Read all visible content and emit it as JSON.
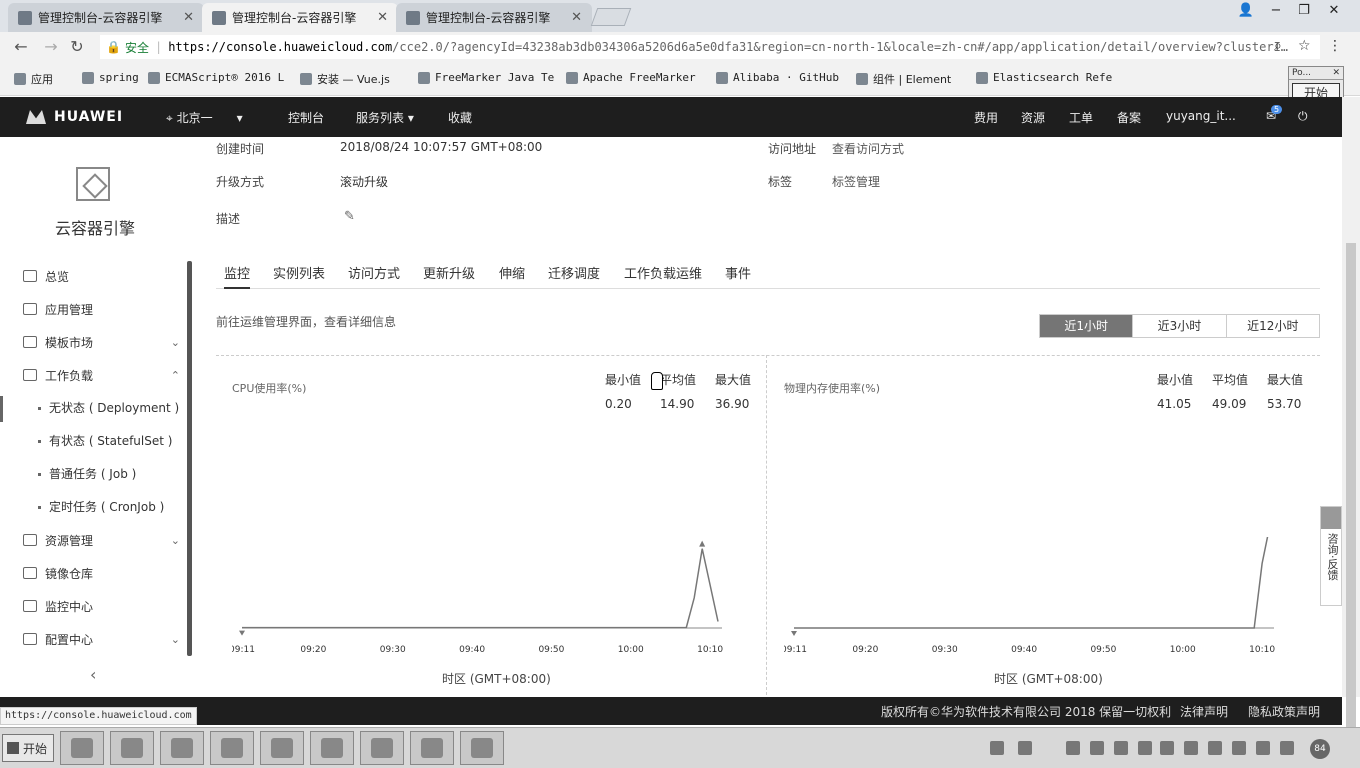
{
  "browser": {
    "tabs": [
      {
        "title": "管理控制台-云容器引擎"
      },
      {
        "title": "管理控制台-云容器引擎"
      },
      {
        "title": "管理控制台-云容器引擎"
      }
    ],
    "security_label": "安全",
    "url_host": "https://console.huaweicloud.com",
    "url_rest": "/cce2.0/?agencyId=43238ab3db034306a5206d6a5e0dfa31&region=cn-north-1&locale=zh-cn#/app/application/detail/overview?clusterI…",
    "bookmarks": [
      {
        "label": "应用"
      },
      {
        "label": "spring"
      },
      {
        "label": "ECMAScript® 2016 L"
      },
      {
        "label": "安装 — Vue.js"
      },
      {
        "label": "FreeMarker Java Te"
      },
      {
        "label": "Apache FreeMarker"
      },
      {
        "label": "Alibaba · GitHub"
      },
      {
        "label": "组件 | Element"
      },
      {
        "label": "Elasticsearch Refe"
      }
    ],
    "popup_title": "Po...",
    "popup_button": "开始"
  },
  "header": {
    "brand": "HUAWEI",
    "region": "北京一",
    "nav": [
      "控制台",
      "服务列表",
      "收藏"
    ],
    "right": [
      "费用",
      "资源",
      "工单",
      "备案",
      "yuyang_it..."
    ],
    "badge": "5"
  },
  "sidebar": {
    "title": "云容器引擎",
    "items": [
      {
        "label": "总览"
      },
      {
        "label": "应用管理"
      },
      {
        "label": "模板市场"
      },
      {
        "label": "工作负载"
      },
      {
        "label": "资源管理"
      },
      {
        "label": "镜像仓库"
      },
      {
        "label": "监控中心"
      },
      {
        "label": "配置中心"
      }
    ],
    "subitems": [
      {
        "label": "无状态 ( Deployment )"
      },
      {
        "label": "有状态 ( StatefulSet )"
      },
      {
        "label": "普通任务 ( Job )"
      },
      {
        "label": "定时任务 ( CronJob )"
      }
    ]
  },
  "detail": {
    "created_label": "创建时间",
    "created_value": "2018/08/24 10:07:57 GMT+08:00",
    "upgrade_label": "升级方式",
    "upgrade_value": "滚动升级",
    "desc_label": "描述",
    "access_label": "访问地址",
    "access_value": "查看访问方式",
    "tag_label": "标签",
    "tag_value": "标签管理"
  },
  "tabs": [
    "监控",
    "实例列表",
    "访问方式",
    "更新升级",
    "伸缩",
    "迁移调度",
    "工作负载运维",
    "事件"
  ],
  "monitor": {
    "hint": "前往运维管理界面，查看详细信息",
    "ranges": [
      "近1小时",
      "近3小时",
      "近12小时"
    ],
    "stat_headers": [
      "最小值",
      "平均值",
      "最大值"
    ],
    "timezone": "时区 (GMT+08:00)"
  },
  "chart_data": [
    {
      "type": "line",
      "title": "CPU使用率(%)",
      "xlabel": "时区 (GMT+08:00)",
      "x_ticks": [
        "09:11",
        "09:20",
        "09:30",
        "09:40",
        "09:50",
        "10:00",
        "10:10"
      ],
      "stats": {
        "min": "0.20",
        "avg": "14.90",
        "max": "36.90"
      },
      "series": [
        {
          "points": [
            [
              "09:11",
              0.2
            ],
            [
              "09:20",
              0.2
            ],
            [
              "09:30",
              0.2
            ],
            [
              "09:40",
              0.2
            ],
            [
              "09:50",
              0.2
            ],
            [
              "10:00",
              0.2
            ],
            [
              "10:07",
              0.2
            ],
            [
              "10:08",
              14.0
            ],
            [
              "10:09",
              36.9
            ],
            [
              "10:10",
              20.0
            ],
            [
              "10:11",
              3.0
            ]
          ]
        }
      ]
    },
    {
      "type": "line",
      "title": "物理内存使用率(%)",
      "xlabel": "时区 (GMT+08:00)",
      "x_ticks": [
        "09:11",
        "09:20",
        "09:30",
        "09:40",
        "09:50",
        "10:00",
        "10:10"
      ],
      "stats": {
        "min": "41.05",
        "avg": "49.09",
        "max": "53.70"
      },
      "series": [
        {
          "points": [
            [
              "09:11",
              0
            ],
            [
              "09:20",
              0
            ],
            [
              "09:30",
              0
            ],
            [
              "09:40",
              0
            ],
            [
              "09:50",
              0
            ],
            [
              "10:00",
              0
            ],
            [
              "10:09",
              0
            ],
            [
              "10:10",
              30.0
            ],
            [
              "10:11",
              48.0
            ],
            [
              "10:12",
              52.0
            ],
            [
              "10:13",
              53.7
            ]
          ]
        }
      ]
    }
  ],
  "feedback": "咨询·反馈",
  "footer": {
    "copyright": "版权所有©华为软件技术有限公司 2018 保留一切权利",
    "legal": "法律声明",
    "privacy": "隐私政策声明"
  },
  "statusbar_url": "https://console.huaweicloud.com",
  "taskbar": {
    "start": "开始",
    "clock": "84"
  }
}
